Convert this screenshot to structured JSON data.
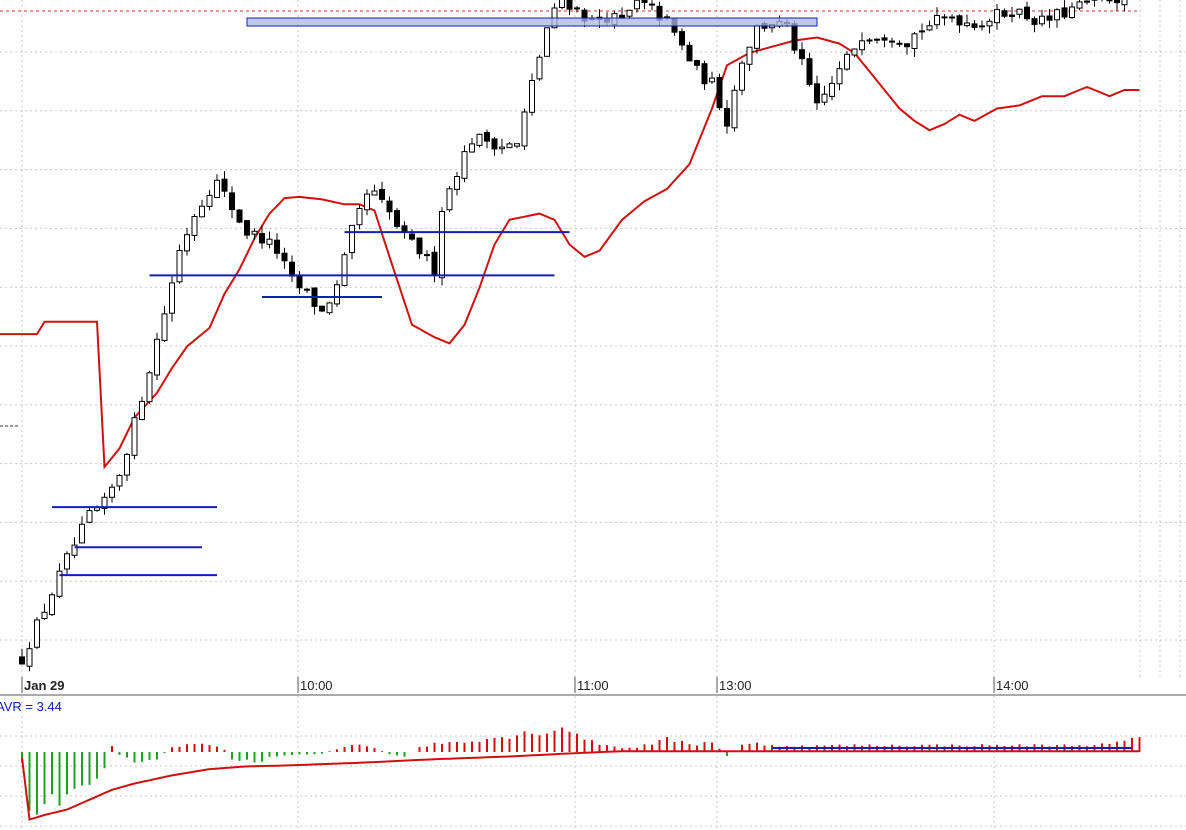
{
  "chart_data": [
    {
      "type": "candlestick",
      "x_tick_labels": [
        "Jan 29",
        "10:00",
        "11:00",
        "13:00",
        "14:00"
      ],
      "y_range": [
        0,
        100
      ],
      "grid": true,
      "reference_line_dashed": 100,
      "colors": {
        "candle": "#000000",
        "vwap": "#d01010",
        "level": "#1020b0",
        "zone": "#aab4ee",
        "grid": "#c8c8c8",
        "ref": "#e03030"
      },
      "vwap": {
        "name": "",
        "keyframes": [
          [
            0,
            49.5
          ],
          [
            2,
            49.5
          ],
          [
            3,
            51.5
          ],
          [
            9,
            51.5
          ],
          [
            10,
            51.5
          ],
          [
            11,
            28
          ],
          [
            13,
            31
          ],
          [
            15,
            36
          ],
          [
            18,
            40
          ],
          [
            20,
            44
          ],
          [
            22,
            47.5
          ],
          [
            25,
            50.5
          ],
          [
            27,
            56
          ],
          [
            29,
            60
          ],
          [
            31,
            65
          ],
          [
            33,
            69
          ],
          [
            35,
            71.5
          ],
          [
            37,
            71.7
          ],
          [
            40,
            71.3
          ],
          [
            43,
            70.5
          ],
          [
            45,
            70.5
          ],
          [
            47,
            69.5
          ],
          [
            49,
            62
          ],
          [
            52,
            51
          ],
          [
            55,
            49
          ],
          [
            57,
            48
          ],
          [
            59,
            51
          ],
          [
            61,
            57
          ],
          [
            63,
            64
          ],
          [
            65,
            68
          ],
          [
            67,
            68.5
          ],
          [
            69,
            69
          ],
          [
            71,
            68
          ],
          [
            73,
            64
          ],
          [
            75,
            62
          ],
          [
            77,
            63
          ],
          [
            80,
            68
          ],
          [
            83,
            71
          ],
          [
            86,
            73
          ],
          [
            89,
            77
          ],
          [
            92,
            86
          ],
          [
            94,
            93
          ],
          [
            97,
            95
          ],
          [
            100,
            96
          ],
          [
            103,
            97
          ],
          [
            106,
            97.5
          ],
          [
            109,
            96.5
          ],
          [
            111,
            95
          ],
          [
            113,
            92
          ],
          [
            115,
            89
          ],
          [
            117,
            86
          ],
          [
            119,
            84
          ],
          [
            121,
            82.5
          ],
          [
            123,
            83.5
          ],
          [
            125,
            85
          ],
          [
            127,
            84
          ],
          [
            130,
            86
          ],
          [
            133,
            86.5
          ],
          [
            136,
            88
          ],
          [
            139,
            88
          ],
          [
            142,
            89.5
          ],
          [
            145,
            88
          ],
          [
            147,
            89
          ],
          [
            150,
            89
          ]
        ]
      },
      "candles_keyframes": [
        [
          0,
          -3
        ],
        [
          3,
          5
        ],
        [
          6,
          13
        ],
        [
          9,
          20
        ],
        [
          11,
          22
        ],
        [
          13,
          27
        ],
        [
          15,
          35
        ],
        [
          17,
          44
        ],
        [
          19,
          53
        ],
        [
          21,
          63
        ],
        [
          23,
          69
        ],
        [
          25,
          73
        ],
        [
          26,
          74
        ],
        [
          28,
          70
        ],
        [
          30,
          66
        ],
        [
          32,
          65
        ],
        [
          34,
          63
        ],
        [
          36,
          58
        ],
        [
          38,
          56
        ],
        [
          40,
          53
        ],
        [
          42,
          57
        ],
        [
          44,
          66
        ],
        [
          46,
          72
        ],
        [
          47,
          72
        ],
        [
          49,
          69
        ],
        [
          51,
          65
        ],
        [
          53,
          63
        ],
        [
          55,
          60
        ],
        [
          56,
          70
        ],
        [
          58,
          76
        ],
        [
          60,
          81
        ],
        [
          62,
          81
        ],
        [
          64,
          80
        ],
        [
          66,
          80
        ],
        [
          68,
          90
        ],
        [
          70,
          99
        ],
        [
          72,
          104
        ],
        [
          74,
          102
        ],
        [
          76,
          100
        ],
        [
          78,
          101
        ],
        [
          80,
          100
        ],
        [
          82,
          103
        ],
        [
          84,
          102
        ],
        [
          86,
          100
        ],
        [
          88,
          96
        ],
        [
          90,
          92
        ],
        [
          92,
          90
        ],
        [
          94,
          84
        ],
        [
          96,
          94
        ],
        [
          98,
          99
        ],
        [
          100,
          100
        ],
        [
          102,
          99
        ],
        [
          104,
          93
        ],
        [
          106,
          86
        ],
        [
          108,
          90
        ],
        [
          110,
          94
        ],
        [
          112,
          98
        ],
        [
          114,
          98
        ],
        [
          116,
          98
        ],
        [
          118,
          97
        ],
        [
          120,
          99
        ],
        [
          122,
          100
        ],
        [
          124,
          101
        ],
        [
          126,
          100
        ],
        [
          128,
          100
        ],
        [
          130,
          101
        ],
        [
          132,
          102
        ],
        [
          134,
          101
        ],
        [
          136,
          100
        ],
        [
          138,
          101
        ],
        [
          140,
          102
        ],
        [
          142,
          103
        ],
        [
          144,
          104
        ],
        [
          146,
          104
        ],
        [
          148,
          105
        ]
      ],
      "levels": [
        {
          "x1": 4,
          "x2": 26,
          "y": 21.5
        },
        {
          "x1": 7,
          "x2": 24,
          "y": 15
        },
        {
          "x1": 5,
          "x2": 26,
          "y": 10.5
        },
        {
          "x1": 17,
          "x2": 71,
          "y": 59
        },
        {
          "x1": 32,
          "x2": 48,
          "y": 55.5
        },
        {
          "x1": 43,
          "x2": 73,
          "y": 66
        },
        {
          "x1": 30,
          "x2": 106,
          "y": 100,
          "zone": true
        }
      ],
      "last_marker": 49
    },
    {
      "type": "bar",
      "label": "AVR = 3.44",
      "label_color": "#1020b0",
      "y_range": [
        -8,
        5
      ],
      "colors": {
        "up": "#d01010",
        "down": "#20a020",
        "avg": "#d01010",
        "avg2": "#1020b0"
      },
      "bars_keyframes": [
        [
          0,
          -1.2
        ],
        [
          1,
          -7
        ],
        [
          3,
          -6
        ],
        [
          6,
          -5
        ],
        [
          9,
          -3.5
        ],
        [
          11,
          -2
        ],
        [
          12,
          0.8
        ],
        [
          13,
          -0.3
        ],
        [
          15,
          -1
        ],
        [
          18,
          -0.8
        ],
        [
          20,
          0.6
        ],
        [
          22,
          0.9
        ],
        [
          25,
          0.8
        ],
        [
          27,
          0.3
        ],
        [
          28,
          -0.8
        ],
        [
          31,
          -1.2
        ],
        [
          33,
          -0.6
        ],
        [
          36,
          -0.3
        ],
        [
          40,
          -0.2
        ],
        [
          43,
          0.6
        ],
        [
          45,
          1
        ],
        [
          47,
          0.5
        ],
        [
          49,
          -0.3
        ],
        [
          51,
          -0.5
        ],
        [
          53,
          0.5
        ],
        [
          55,
          1
        ],
        [
          58,
          1.2
        ],
        [
          61,
          1.5
        ],
        [
          64,
          1.8
        ],
        [
          67,
          2.2
        ],
        [
          70,
          2.5
        ],
        [
          72,
          2.9
        ],
        [
          74,
          2.2
        ],
        [
          76,
          1.2
        ],
        [
          78,
          0.8
        ],
        [
          80,
          0.5
        ],
        [
          82,
          0.6
        ],
        [
          84,
          1
        ],
        [
          86,
          1.5
        ],
        [
          88,
          1.2
        ],
        [
          90,
          0.9
        ],
        [
          92,
          1.3
        ],
        [
          94,
          -0.5
        ],
        [
          96,
          0.8
        ],
        [
          98,
          1
        ],
        [
          100,
          0.8
        ],
        [
          104,
          0.7
        ],
        [
          110,
          0.8
        ],
        [
          120,
          0.8
        ],
        [
          130,
          0.8
        ],
        [
          140,
          0.8
        ],
        [
          145,
          0.9
        ],
        [
          148,
          1.5
        ]
      ],
      "avg_keyframes": [
        [
          0,
          -0.6
        ],
        [
          1,
          -7.5
        ],
        [
          3,
          -7
        ],
        [
          6,
          -6.4
        ],
        [
          9,
          -5.3
        ],
        [
          12,
          -4.2
        ],
        [
          15,
          -3.5
        ],
        [
          20,
          -2.6
        ],
        [
          25,
          -1.9
        ],
        [
          30,
          -1.6
        ],
        [
          35,
          -1.5
        ],
        [
          45,
          -1.2
        ],
        [
          55,
          -0.8
        ],
        [
          65,
          -0.5
        ],
        [
          72,
          -0.2
        ],
        [
          80,
          0.1
        ],
        [
          100,
          0.1
        ],
        [
          148,
          0.1
        ]
      ]
    }
  ]
}
